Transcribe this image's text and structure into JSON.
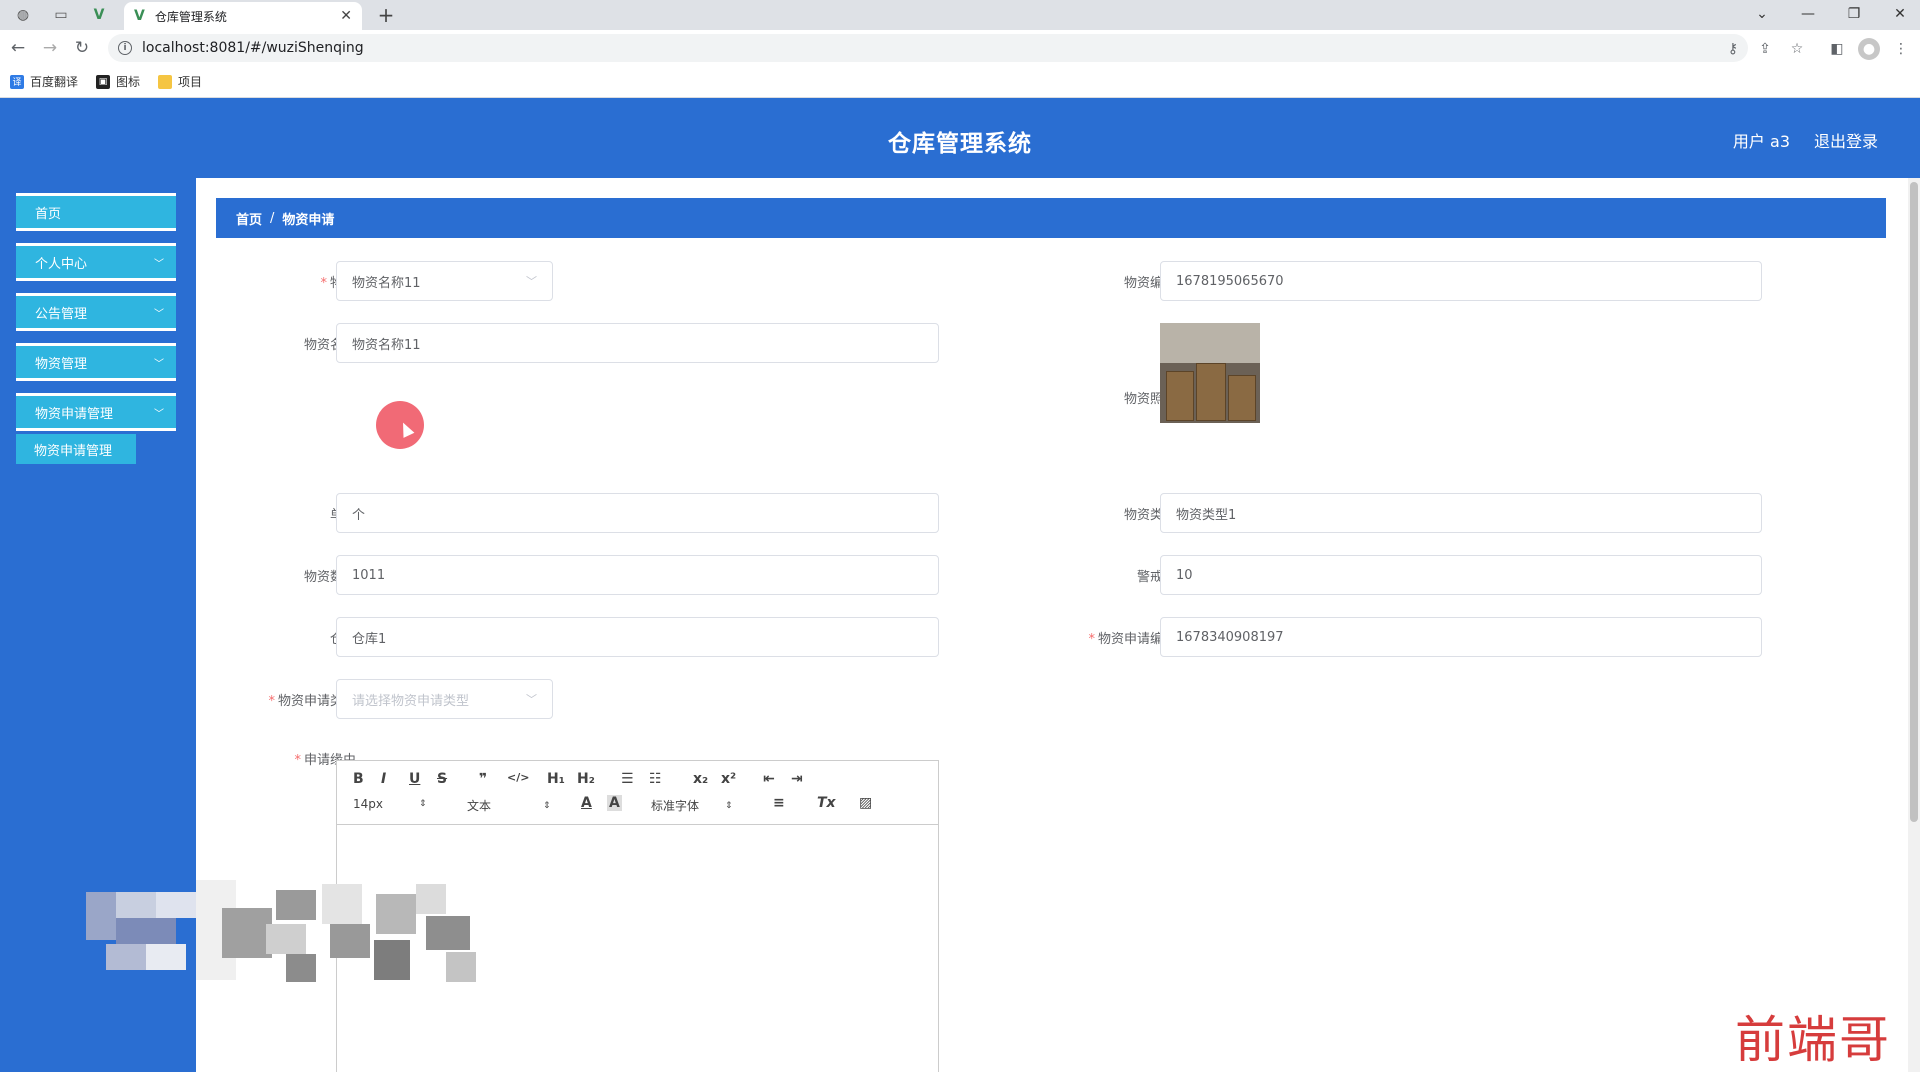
{
  "browser": {
    "tab_title": "仓库管理系统",
    "url": "localhost:8081/#/wuziShenqing",
    "bookmarks": [
      "百度翻译",
      "图标",
      "项目"
    ]
  },
  "header": {
    "title": "仓库管理系统",
    "user": "用户 a3",
    "logout": "退出登录"
  },
  "sidebar": {
    "items": [
      {
        "label": "首页"
      },
      {
        "label": "个人中心"
      },
      {
        "label": "公告管理"
      },
      {
        "label": "物资管理"
      },
      {
        "label": "物资申请管理"
      }
    ],
    "sub_item": "物资申请管理"
  },
  "breadcrumb": {
    "home": "首页",
    "separator": "/",
    "current": "物资申请"
  },
  "form": {
    "wuzi_label": "物资",
    "wuzi_value": "物资名称11",
    "code_label": "物资编号",
    "code_value": "1678195065670",
    "name_label": "物资名称",
    "name_value": "物资名称11",
    "photo_label": "物资照片",
    "unit_label": "单位",
    "unit_value": "个",
    "type_label": "物资类型",
    "type_value": "物资类型1",
    "qty_label": "物资数量",
    "qty_value": "1011",
    "warn_label": "警戒值",
    "warn_value": "10",
    "warehouse_label": "仓库",
    "warehouse_value": "仓库1",
    "apply_code_label": "物资申请编号",
    "apply_code_value": "1678340908197",
    "apply_type_label": "物资申请类型",
    "apply_type_placeholder": "请选择物资申请类型",
    "reason_label": "申请缘由"
  },
  "editor": {
    "font_size": "14px",
    "paragraph": "文本",
    "font_family": "标准字体"
  },
  "watermark": "前端哥",
  "colors": {
    "primary": "#2a6ed2",
    "sidebar_item": "#2fb5e0",
    "required": "#f56c6c"
  }
}
